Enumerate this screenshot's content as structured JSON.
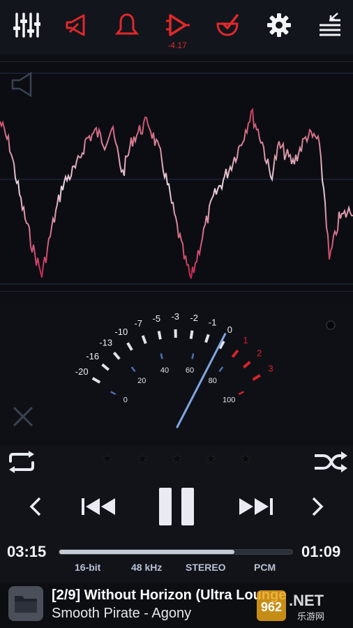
{
  "toolbar": {
    "buttons": [
      {
        "name": "equalizer-sliders-icon"
      },
      {
        "name": "volume-icon"
      },
      {
        "name": "bell-icon"
      },
      {
        "name": "play-gain-icon"
      },
      {
        "name": "check-bowl-icon"
      },
      {
        "name": "gear-icon"
      },
      {
        "name": "queue-menu-icon"
      }
    ],
    "gain_value": "-4.17"
  },
  "colors": {
    "accent_red": "#e0282b",
    "wave_pink": "#c8395a",
    "wave_white": "#e9d8de",
    "vu_needle": "#7fa6e0"
  },
  "vu_meter": {
    "db_labels": [
      "-20",
      "-16",
      "-13",
      "-10",
      "-7",
      "-5",
      "-3",
      "-2",
      "-1",
      "0",
      "1",
      "2",
      "3"
    ],
    "percent_labels": [
      "0",
      "20",
      "40",
      "60",
      "80",
      "100"
    ],
    "needle_percent": 72
  },
  "rating": {
    "stars": 5,
    "value": 0
  },
  "playback": {
    "elapsed": "03:15",
    "remaining": "01:09",
    "progress": 0.75,
    "state": "playing"
  },
  "format": {
    "bit_depth": "16-bit",
    "sample_rate": "48 kHz",
    "channels": "STEREO",
    "codec": "PCM"
  },
  "track": {
    "title": "[2/9] Without Horizon (Ultra Lounge",
    "artist": "Smooth Pirate - Agony"
  },
  "watermark": {
    "text": "962.NET",
    "subtext": "乐游网"
  }
}
